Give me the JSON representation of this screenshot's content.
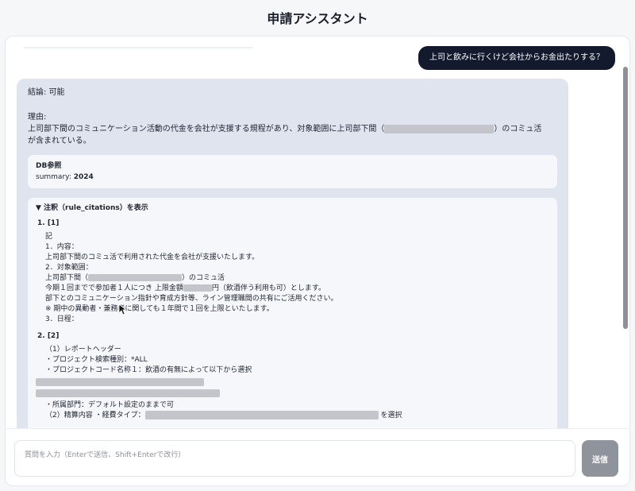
{
  "app": {
    "title": "申請アシスタント"
  },
  "user_message": "上司と飲みに行くけど会社からお金出たりする？",
  "assistant": {
    "conclusion": "結論: 可能",
    "reason_label": "理由:",
    "reason_line1_pre": "上司部下間のコミュニケーション活動の代金を会社が支援する規程があり、対象範囲に上司部下間（",
    "reason_line1_post": "）のコミュ活",
    "reason_line2": "が含まれている。",
    "db": {
      "title": "DB参照",
      "summary_label": "summary: ",
      "summary_value": "2024"
    },
    "citations": {
      "summary": "▼ 注釈（rule_citations）を表示",
      "item1": {
        "number": "1. [1]",
        "lines": {
          "l1": "記",
          "l2": "1．内容：",
          "l3": "上司部下間のコミュ活で利用された代金を会社が支援いたします。",
          "l4": "2．対象範囲：",
          "l5_pre": "上司部下間（",
          "l5_post": "）のコミュ活",
          "l6_pre": "今期１回までで参加者１人につき 上限金額",
          "l6_post": "円（飲酒伴う利用も可）とします。",
          "l7": "部下とのコミュニケーション指針や育成方針等、ライン管理職間の共有にご活用ください。",
          "l8": "※ 期中の異動者・兼務者に関しても１年間で１回を上限といたします。",
          "l9": "3．日程："
        }
      },
      "item2": {
        "number": "2. [2]",
        "lines": {
          "l1": "（1）レポートヘッダー",
          "l2": "・プロジェクト検索種別：*ALL",
          "l3": "・プロジェクトコード名称１：飲酒の有無によって以下から選択",
          "l4": "・所属部門：デフォルト設定のままで可",
          "l5_pre": "（2）精算内容 ・経費タイプ：",
          "l5_post": "を選択"
        }
      }
    }
  },
  "input": {
    "placeholder": "質問を入力（Enterで送信、Shift+Enterで改行）",
    "value": ""
  },
  "send_button": {
    "label": "送信"
  },
  "colors": {
    "user_bubble": "#131a2e",
    "assistant_card": "#dfe4ef",
    "send_button": "#8f939b"
  }
}
